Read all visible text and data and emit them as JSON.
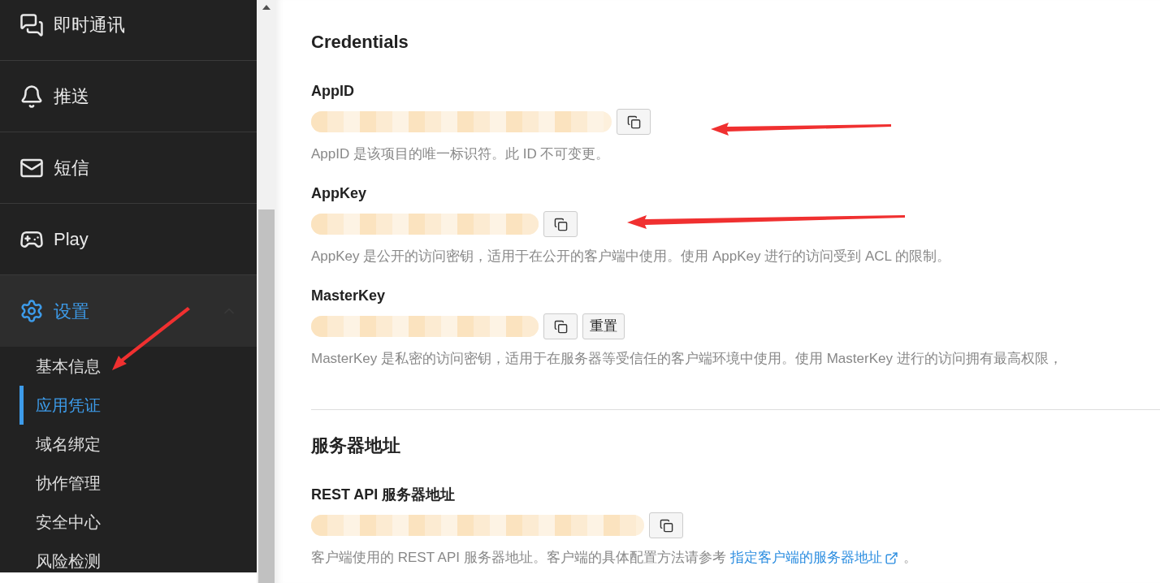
{
  "sidebar": {
    "items": [
      {
        "label": "即时通讯",
        "expanded": false
      },
      {
        "label": "推送",
        "expanded": false
      },
      {
        "label": "短信",
        "expanded": false
      },
      {
        "label": "Play",
        "expanded": false
      },
      {
        "label": "设置",
        "expanded": true,
        "children": [
          {
            "label": "基本信息",
            "selected": false
          },
          {
            "label": "应用凭证",
            "selected": true
          },
          {
            "label": "域名绑定",
            "selected": false
          },
          {
            "label": "协作管理",
            "selected": false
          },
          {
            "label": "安全中心",
            "selected": false
          },
          {
            "label": "风险检测",
            "selected": false
          }
        ]
      }
    ]
  },
  "sections": [
    {
      "title": "Credentials",
      "fields": [
        {
          "label": "AppID",
          "description": "AppID 是该项目的唯一标识符。此 ID 不可变更。"
        },
        {
          "label": "AppKey",
          "description": "AppKey 是公开的访问密钥，适用于在公开的客户端中使用。使用 AppKey 进行的访问受到 ACL 的限制。"
        },
        {
          "label": "MasterKey",
          "reset_button": "重置",
          "description": "MasterKey 是私密的访问密钥，适用于在服务器等受信任的客户端环境中使用。使用 MasterKey 进行的访问拥有最高权限，"
        }
      ]
    },
    {
      "title": "服务器地址",
      "fields": [
        {
          "label": "REST API 服务器地址",
          "description": "客户端使用的 REST API 服务器地址。客户端的具体配置方法请参考",
          "link": "指定客户端的服务器地址",
          "after_link": "。"
        }
      ]
    }
  ]
}
